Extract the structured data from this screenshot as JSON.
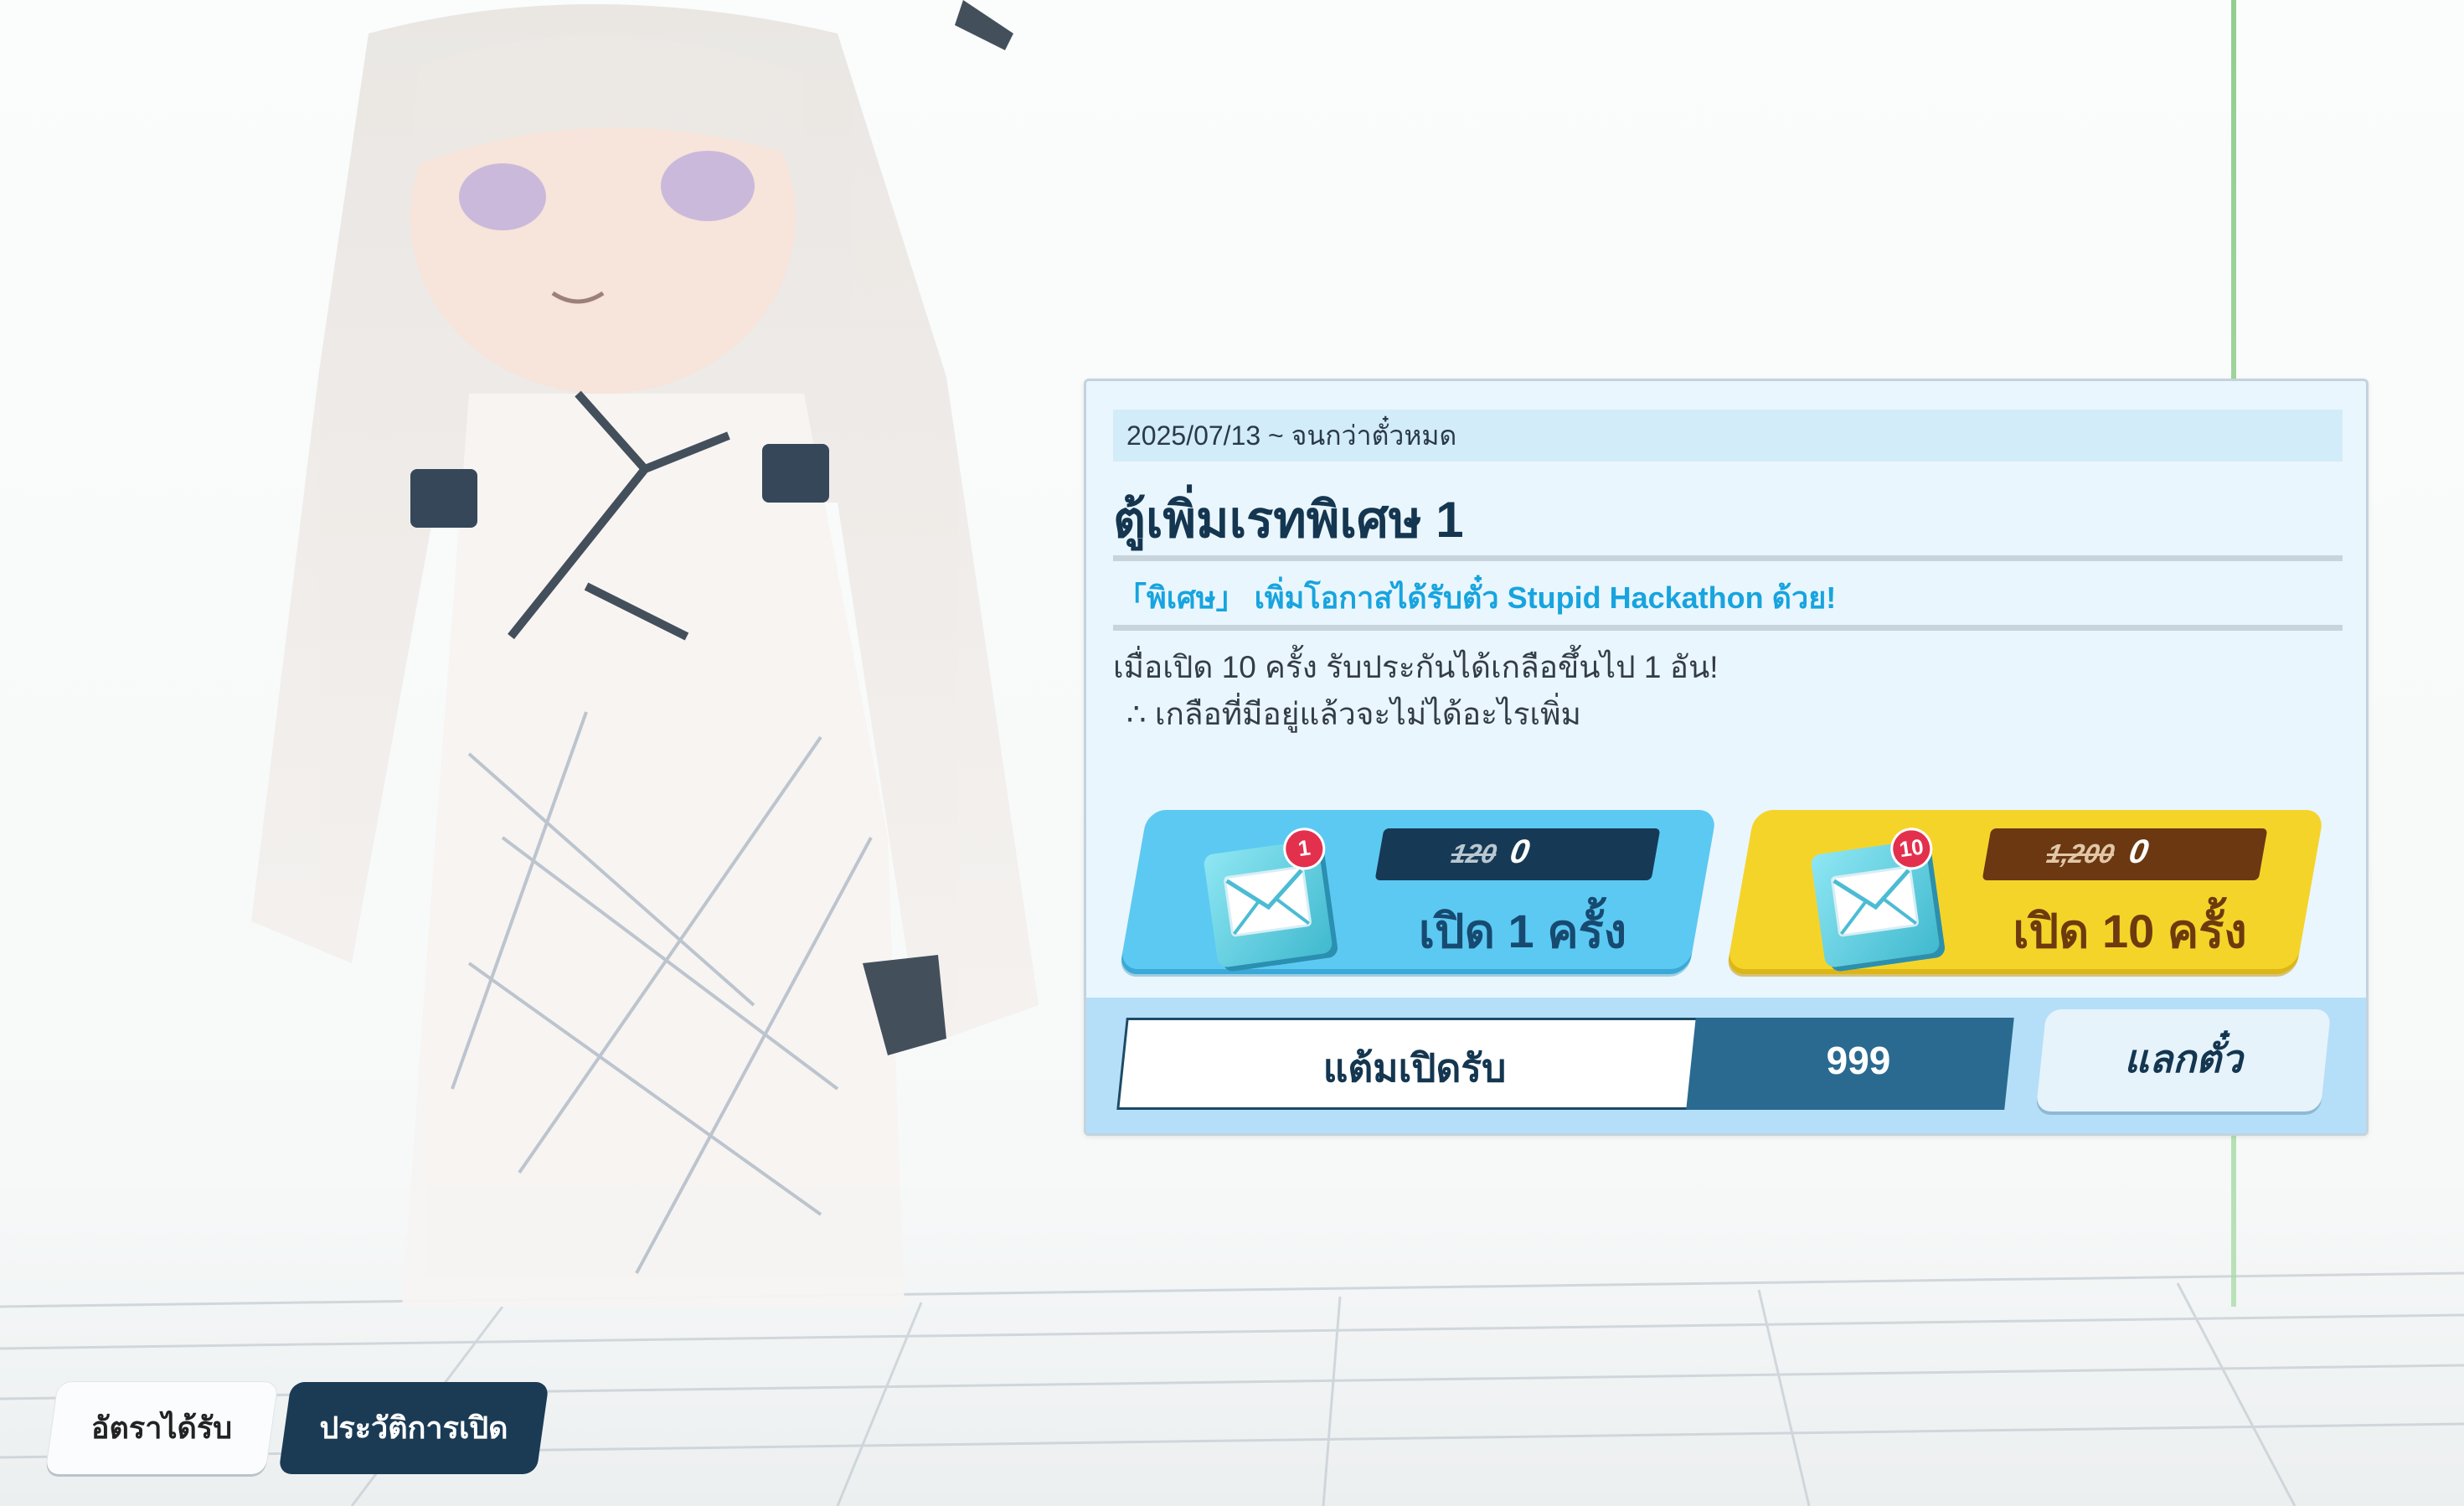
{
  "banner": {
    "date_range": "2025/07/13 ~ จนกว่าตั๋วหมด",
    "title": "ตู้เพิ่มเรทพิเศษ 1",
    "subtitle": "「พิเศษ」 เพิ่มโอกาสได้รับตั๋ว Stupid Hackathon ด้วย!",
    "description_line1": "เมื่อเปิด 10 ครั้ง รับประกันได้เกลือขึ้นไป 1 อัน!",
    "description_line2": "∴ เกลือที่มีอยู่แล้วจะไม่ได้อะไรเพิ่ม"
  },
  "pulls": [
    {
      "badge": "1",
      "old_price": "120",
      "new_price": "0",
      "label": "เปิด 1 ครั้ง",
      "color": "#5cc9f3",
      "icon": "mail-ticket-icon"
    },
    {
      "badge": "10",
      "old_price": "1,200",
      "new_price": "0",
      "label": "เปิด 10 ครั้ง",
      "color": "#f5d42a",
      "icon": "mail-ticket-icon"
    }
  ],
  "points": {
    "label": "แต้มเปิดรับ",
    "value": "999",
    "exchange_label": "แลกตั๋ว"
  },
  "tabs": {
    "rates_label": "อัตราได้รับ",
    "history_label": "ประวัติการเปิด"
  },
  "colors": {
    "panel_bg": "#eaf6fd",
    "accent_blue": "#17a4df",
    "dark_navy": "#143650"
  }
}
